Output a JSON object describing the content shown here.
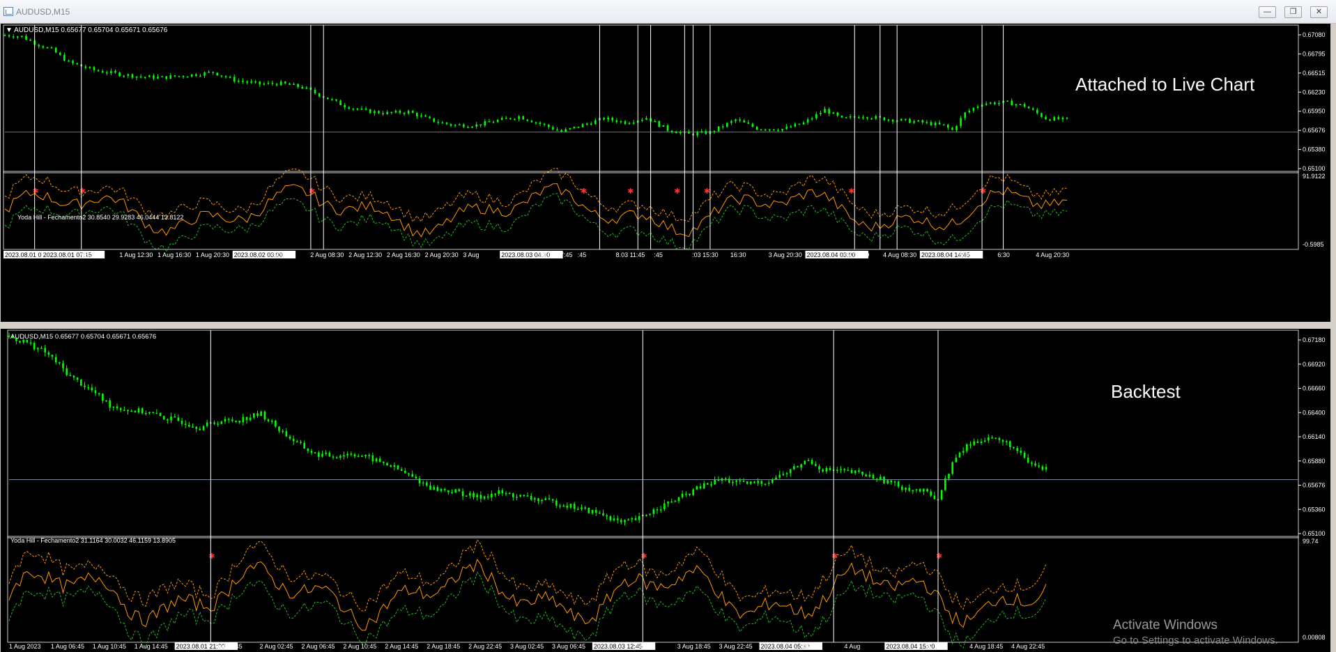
{
  "window": {
    "title": "AUDUSD,M15",
    "icon": "chart-window-icon",
    "buttons": [
      "minimize-icon",
      "restore-icon",
      "close-icon"
    ]
  },
  "colors": {
    "background": "#000000",
    "candle": "#00ff00",
    "band_upper": "#ff9900",
    "band_lower": "#22bb22",
    "indicator_line": "#ff9900",
    "signal_marker": "#ff3030",
    "vline": "#ffffff",
    "text": "#ffffff"
  },
  "top": {
    "header": "AUDUSD,M15  0.65677 0.65704 0.65671 0.65676",
    "overlay": "Attached to Live Chart",
    "price_labels": [
      "0.67080",
      "0.66795",
      "0.66515",
      "0.66230",
      "0.65950",
      "0.65676",
      "0.65380",
      "0.65100"
    ],
    "indicator_header": "Yoda Hill - Fechamento2 30.8540 29.9283 46.0444 13.8122",
    "indicator_labels": [
      "91.9122",
      "-0.5985"
    ],
    "time_labels": [
      "2023.08.01 03:00",
      "2023.08.01 07:15",
      "08:30",
      "1 Aug 12:30",
      "1 Aug 16:30",
      "1 Aug 20:30",
      "2023.08.02 03:00",
      "04:30",
      "2 Aug 08:30",
      "2 Aug 12:30",
      "2 Aug 16:30",
      "2 Aug 20:30",
      "3 Aug",
      "2023.08.03 04:30",
      "08.03 07:45",
      ":45",
      "8.03 11:45",
      ":45",
      ":03 15:30",
      "16:30",
      "3 Aug 20:30",
      "2023.08.04 03:00",
      "04 05:30",
      "4 Aug 08:30",
      "2023.08.04 14:45",
      "5:00",
      "6:30",
      "4 Aug 20:30"
    ],
    "chart_data": {
      "type": "candlestick",
      "symbol": "AUDUSD",
      "timeframe": "M15",
      "ohlc_last": {
        "open": 0.65677,
        "high": 0.65704,
        "low": 0.65671,
        "close": 0.65676
      },
      "ylim": [
        0.651,
        0.6725
      ],
      "close_path": [
        [
          0,
          0.6714
        ],
        [
          4,
          0.6712
        ],
        [
          7,
          0.6702
        ],
        [
          11,
          0.6692
        ],
        [
          15,
          0.6673
        ],
        [
          21,
          0.6661
        ],
        [
          27,
          0.6655
        ],
        [
          32,
          0.6651
        ],
        [
          37,
          0.665
        ],
        [
          44,
          0.6654
        ],
        [
          49,
          0.6658
        ],
        [
          54,
          0.6646
        ],
        [
          60,
          0.664
        ],
        [
          65,
          0.6641
        ],
        [
          70,
          0.6635
        ],
        [
          75,
          0.6621
        ],
        [
          80,
          0.6607
        ],
        [
          85,
          0.6599
        ],
        [
          90,
          0.6596
        ],
        [
          95,
          0.6598
        ],
        [
          100,
          0.6586
        ],
        [
          105,
          0.6578
        ],
        [
          111,
          0.6578
        ],
        [
          116,
          0.6585
        ],
        [
          121,
          0.6591
        ],
        [
          126,
          0.658
        ],
        [
          131,
          0.6568
        ],
        [
          136,
          0.6578
        ],
        [
          141,
          0.6588
        ],
        [
          146,
          0.6582
        ],
        [
          151,
          0.6589
        ],
        [
          156,
          0.6571
        ],
        [
          161,
          0.6564
        ],
        [
          166,
          0.6567
        ],
        [
          172,
          0.6586
        ],
        [
          177,
          0.6573
        ],
        [
          183,
          0.6572
        ],
        [
          188,
          0.6581
        ],
        [
          193,
          0.6601
        ],
        [
          197,
          0.6587
        ],
        [
          202,
          0.6592
        ],
        [
          206,
          0.6588
        ],
        [
          211,
          0.6585
        ],
        [
          216,
          0.6582
        ],
        [
          221,
          0.6577
        ],
        [
          223,
          0.657
        ],
        [
          226,
          0.6596
        ],
        [
          230,
          0.6611
        ],
        [
          236,
          0.6612
        ],
        [
          240,
          0.6607
        ],
        [
          245,
          0.6588
        ],
        [
          250,
          0.6586
        ]
      ],
      "indicator": {
        "name": "Yoda Hill - Fechamento2",
        "values": [
          30.854,
          29.9283,
          46.0444,
          13.8122
        ],
        "ylim": [
          -0.5985,
          91.9122
        ],
        "signal_bars": [
          30,
          82,
          125,
          142,
          186,
          192,
          200,
          206,
          223,
          245,
          252,
          276,
          278,
          296
        ],
        "marked_signals": [
          7,
          18,
          72,
          136,
          147,
          158,
          165,
          199,
          230
        ]
      },
      "vertical_line_bars": [
        7,
        18,
        72,
        75,
        140,
        149,
        152,
        160,
        162,
        166,
        200,
        206,
        210,
        230,
        235
      ]
    }
  },
  "bottom": {
    "header": "AUDUSD,M15  0.65677 0.65704 0.65671 0.65676",
    "overlay": "Backtest",
    "price_labels": [
      "0.67180",
      "0.66920",
      "0.66660",
      "0.66400",
      "0.66140",
      "0.65880",
      "0.65676",
      "0.65360",
      "0.65100"
    ],
    "indicator_header": "Yoda Hill - Fechamento2 31.1164 30.0032 46.1159 13.8905",
    "indicator_labels": [
      "99.74",
      "0.00808"
    ],
    "time_labels": [
      "1 Aug 2023",
      "1 Aug 06:45",
      "1 Aug 10:45",
      "1 Aug 14:45",
      "2023.08.01 21:00",
      "ug 22:45",
      "2 Aug 02:45",
      "2 Aug 06:45",
      "2 Aug 10:45",
      "2 Aug 14:45",
      "2 Aug 18:45",
      "2 Aug 22:45",
      "3 Aug 02:45",
      "3 Aug 06:45",
      "2023.08.03 12:45",
      "14:45",
      "3 Aug 18:45",
      "3 Aug 22:45",
      "2023.08.04 05:30",
      "06:45",
      "4 Aug",
      "2023.08.04 15:00",
      "5",
      "4 Aug 18:45",
      "4 Aug 22:45"
    ],
    "chart_data": {
      "type": "candlestick",
      "symbol": "AUDUSD",
      "timeframe": "M15",
      "ohlc_last": {
        "open": 0.65677,
        "high": 0.65704,
        "low": 0.65671,
        "close": 0.65676
      },
      "ylim": [
        0.651,
        0.672
      ],
      "close_path": [
        [
          0,
          0.6716
        ],
        [
          5,
          0.671
        ],
        [
          10,
          0.67
        ],
        [
          13,
          0.669
        ],
        [
          17,
          0.6675
        ],
        [
          23,
          0.666
        ],
        [
          28,
          0.6645
        ],
        [
          33,
          0.664
        ],
        [
          38,
          0.6638
        ],
        [
          43,
          0.6632
        ],
        [
          48,
          0.6628
        ],
        [
          53,
          0.6622
        ],
        [
          58,
          0.6628
        ],
        [
          64,
          0.663
        ],
        [
          70,
          0.6636
        ],
        [
          75,
          0.662
        ],
        [
          80,
          0.6605
        ],
        [
          85,
          0.6594
        ],
        [
          90,
          0.6592
        ],
        [
          95,
          0.6595
        ],
        [
          100,
          0.659
        ],
        [
          106,
          0.6582
        ],
        [
          112,
          0.657
        ],
        [
          118,
          0.6558
        ],
        [
          124,
          0.6555
        ],
        [
          130,
          0.6549
        ],
        [
          136,
          0.6554
        ],
        [
          142,
          0.655
        ],
        [
          148,
          0.6546
        ],
        [
          154,
          0.6542
        ],
        [
          160,
          0.6536
        ],
        [
          166,
          0.653
        ],
        [
          170,
          0.6522
        ],
        [
          175,
          0.6527
        ],
        [
          180,
          0.6538
        ],
        [
          186,
          0.6548
        ],
        [
          192,
          0.656
        ],
        [
          198,
          0.6568
        ],
        [
          204,
          0.6563
        ],
        [
          210,
          0.6565
        ],
        [
          216,
          0.6575
        ],
        [
          222,
          0.6588
        ],
        [
          226,
          0.6578
        ],
        [
          230,
          0.6577
        ],
        [
          236,
          0.6574
        ],
        [
          242,
          0.6568
        ],
        [
          248,
          0.656
        ],
        [
          254,
          0.6555
        ],
        [
          258,
          0.6548
        ],
        [
          262,
          0.6585
        ],
        [
          266,
          0.6603
        ],
        [
          272,
          0.6612
        ],
        [
          278,
          0.6604
        ],
        [
          283,
          0.6585
        ],
        [
          288,
          0.6578
        ]
      ],
      "indicator": {
        "name": "Yoda Hill - Fechamento2",
        "values": [
          31.1164,
          30.0032,
          46.1159,
          13.8905
        ],
        "ylim": [
          0.00808,
          99.74
        ],
        "marked_signals": [
          56,
          176,
          229,
          258
        ]
      },
      "vertical_line_bars": [
        56,
        176,
        229,
        258
      ]
    }
  }
}
